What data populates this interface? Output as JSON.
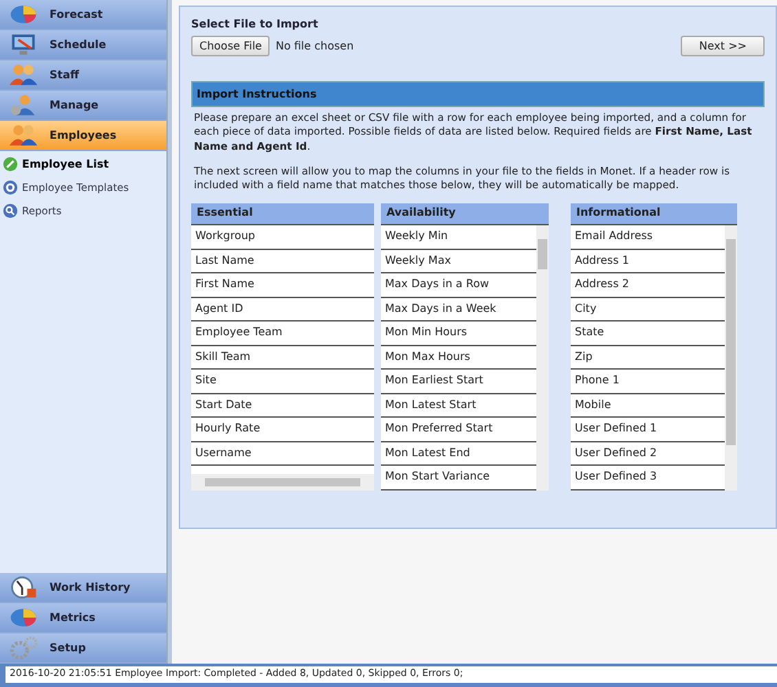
{
  "nav_top": [
    {
      "label": "Forecast",
      "selected": false
    },
    {
      "label": "Schedule",
      "selected": false
    },
    {
      "label": "Staff",
      "selected": false
    },
    {
      "label": "Manage",
      "selected": false
    },
    {
      "label": "Employees",
      "selected": true
    }
  ],
  "sub_items": [
    {
      "label": "Employee List",
      "selected": true
    },
    {
      "label": "Employee Templates",
      "selected": false
    },
    {
      "label": "Reports",
      "selected": false
    }
  ],
  "nav_bottom": [
    {
      "label": "Work History",
      "selected": false
    },
    {
      "label": "Metrics",
      "selected": false
    },
    {
      "label": "Setup",
      "selected": false
    }
  ],
  "file_section": {
    "title": "Select File to Import",
    "choose_button": "Choose File",
    "file_status": "No file chosen",
    "next_button": "Next >>"
  },
  "instructions": {
    "title": "Import Instructions",
    "paragraphs": [
      "Please prepare an excel sheet or CSV file with a row for each employee being imported, and a column for each piece of data imported. Possible fields of data are listed below. Required fields are **First Name, Last Name and Agent Id**.",
      "The next screen will allow you to map the columns in your file to the fields in Monet. If a header row is included with a field name that matches those below, they will be automatically be mapped."
    ]
  },
  "lists": [
    {
      "title": "Essential",
      "items": [
        "Workgroup",
        "Last Name",
        "First Name",
        "Agent ID",
        "Employee Team",
        "Skill Team",
        "Site",
        "Start Date",
        "Hourly Rate",
        "Username"
      ]
    },
    {
      "title": "Availability",
      "items": [
        "Weekly Min",
        "Weekly Max",
        "Max Days in a Row",
        "Max Days in a Week",
        "Mon Min Hours",
        "Mon Max Hours",
        "Mon Earliest Start",
        "Mon Latest Start",
        "Mon Preferred Start",
        "Mon Latest End",
        "Mon Start Variance"
      ]
    },
    {
      "title": "Informational",
      "items": [
        "Email Address",
        "Address 1",
        "Address 2",
        "City",
        "State",
        "Zip",
        "Phone 1",
        "Mobile",
        "User Defined 1",
        "User Defined 2",
        "User Defined 3"
      ]
    }
  ],
  "status_bar": "2016-10-20 21:05:51 Employee Import: Completed - Added 8, Updated 0, Skipped 0, Errors 0;"
}
